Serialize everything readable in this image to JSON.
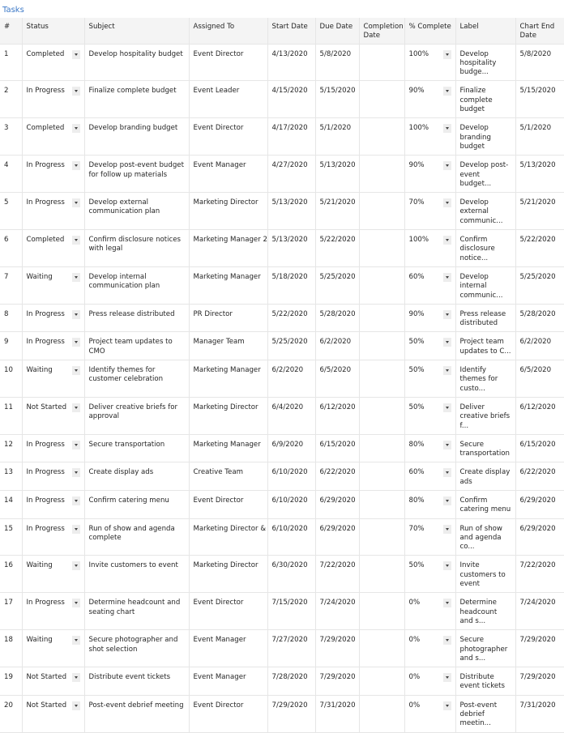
{
  "title": "Tasks",
  "columns": {
    "num": "#",
    "status": "Status",
    "subject": "Subject",
    "assigned": "Assigned To",
    "start": "Start Date",
    "due": "Due Date",
    "completion": "Completion Date",
    "pct": "% Complete",
    "label": "Label",
    "chart_end": "Chart End Date"
  },
  "rows": [
    {
      "num": "1",
      "status": "Completed",
      "subject": "Develop hospitality budget",
      "assigned": "Event Director",
      "start": "4/13/2020",
      "due": "5/8/2020",
      "completion": "",
      "pct": "100%",
      "label": "Develop hospitality budge...",
      "chart_end": "5/8/2020"
    },
    {
      "num": "2",
      "status": "In Progress",
      "subject": "Finalize complete budget",
      "assigned": "Event Leader",
      "start": "4/15/2020",
      "due": "5/15/2020",
      "completion": "",
      "pct": "90%",
      "label": "Finalize complete budget",
      "chart_end": "5/15/2020"
    },
    {
      "num": "3",
      "status": "Completed",
      "subject": "Develop branding budget",
      "assigned": "Event Director",
      "start": "4/17/2020",
      "due": "5/1/2020",
      "completion": "",
      "pct": "100%",
      "label": "Develop branding budget",
      "chart_end": "5/1/2020"
    },
    {
      "num": "4",
      "status": "In Progress",
      "subject": "Develop post-event budget for follow up materials",
      "assigned": "Event Manager",
      "start": "4/27/2020",
      "due": "5/13/2020",
      "completion": "",
      "pct": "90%",
      "label": "Develop post-event budget...",
      "chart_end": "5/13/2020"
    },
    {
      "num": "5",
      "status": "In Progress",
      "subject": "Develop external communication plan",
      "assigned": "Marketing Director",
      "start": "5/13/2020",
      "due": "5/21/2020",
      "completion": "",
      "pct": "70%",
      "label": "Develop external communic...",
      "chart_end": "5/21/2020"
    },
    {
      "num": "6",
      "status": "Completed",
      "subject": "Confirm disclosure notices with legal",
      "assigned": "Marketing Manager 2",
      "start": "5/13/2020",
      "due": "5/22/2020",
      "completion": "",
      "pct": "100%",
      "label": "Confirm disclosure notice...",
      "chart_end": "5/22/2020"
    },
    {
      "num": "7",
      "status": "Waiting",
      "subject": "Develop internal communication plan",
      "assigned": "Marketing Manager",
      "start": "5/18/2020",
      "due": "5/25/2020",
      "completion": "",
      "pct": "60%",
      "label": "Develop internal communic...",
      "chart_end": "5/25/2020"
    },
    {
      "num": "8",
      "status": "In Progress",
      "subject": "Press release distributed",
      "assigned": "PR Director",
      "start": "5/22/2020",
      "due": "5/28/2020",
      "completion": "",
      "pct": "90%",
      "label": "Press release distributed",
      "chart_end": "5/28/2020"
    },
    {
      "num": "9",
      "status": "In Progress",
      "subject": "Project team updates to CMO",
      "assigned": "Manager Team",
      "start": "5/25/2020",
      "due": "6/2/2020",
      "completion": "",
      "pct": "50%",
      "label": "Project team updates to C...",
      "chart_end": "6/2/2020"
    },
    {
      "num": "10",
      "status": "Waiting",
      "subject": "Identify themes for customer celebration",
      "assigned": "Marketing Manager",
      "start": "6/2/2020",
      "due": "6/5/2020",
      "completion": "",
      "pct": "50%",
      "label": "Identify themes for custo...",
      "chart_end": "6/5/2020"
    },
    {
      "num": "11",
      "status": "Not Started",
      "subject": "Deliver creative briefs for approval",
      "assigned": "Marketing Director",
      "start": "6/4/2020",
      "due": "6/12/2020",
      "completion": "",
      "pct": "50%",
      "label": "Deliver creative briefs f...",
      "chart_end": "6/12/2020"
    },
    {
      "num": "12",
      "status": "In Progress",
      "subject": "Secure transportation",
      "assigned": "Marketing Manager",
      "start": "6/9/2020",
      "due": "6/15/2020",
      "completion": "",
      "pct": "80%",
      "label": "Secure transportation",
      "chart_end": "6/15/2020"
    },
    {
      "num": "13",
      "status": "In Progress",
      "subject": "Create display ads",
      "assigned": "Creative Team",
      "start": "6/10/2020",
      "due": "6/22/2020",
      "completion": "",
      "pct": "60%",
      "label": "Create display ads",
      "chart_end": "6/22/2020"
    },
    {
      "num": "14",
      "status": "In Progress",
      "subject": "Confirm catering menu",
      "assigned": "Event Director",
      "start": "6/10/2020",
      "due": "6/29/2020",
      "completion": "",
      "pct": "80%",
      "label": "Confirm catering menu",
      "chart_end": "6/29/2020"
    },
    {
      "num": "15",
      "status": "In Progress",
      "subject": "Run of show and agenda complete",
      "assigned": "Marketing Director & E",
      "start": "6/10/2020",
      "due": "6/29/2020",
      "completion": "",
      "pct": "70%",
      "label": "Run of show and agenda co...",
      "chart_end": "6/29/2020"
    },
    {
      "num": "16",
      "status": "Waiting",
      "subject": "Invite customers to event",
      "assigned": "Marketing Director",
      "start": "6/30/2020",
      "due": "7/22/2020",
      "completion": "",
      "pct": "50%",
      "label": "Invite customers to event",
      "chart_end": "7/22/2020"
    },
    {
      "num": "17",
      "status": "In Progress",
      "subject": "Determine headcount and seating chart",
      "assigned": "Event Director",
      "start": "7/15/2020",
      "due": "7/24/2020",
      "completion": "",
      "pct": "0%",
      "label": "Determine headcount and s...",
      "chart_end": "7/24/2020"
    },
    {
      "num": "18",
      "status": "Waiting",
      "subject": "Secure photographer and shot selection",
      "assigned": "Event Manager",
      "start": "7/27/2020",
      "due": "7/29/2020",
      "completion": "",
      "pct": "0%",
      "label": "Secure photographer and s...",
      "chart_end": "7/29/2020"
    },
    {
      "num": "19",
      "status": "Not Started",
      "subject": "Distribute event tickets",
      "assigned": "Event Manager",
      "start": "7/28/2020",
      "due": "7/29/2020",
      "completion": "",
      "pct": "0%",
      "label": "Distribute event tickets",
      "chart_end": "7/29/2020"
    },
    {
      "num": "20",
      "status": "Not Started",
      "subject": "Post-event debrief meeting",
      "assigned": "Event Director",
      "start": "7/29/2020",
      "due": "7/31/2020",
      "completion": "",
      "pct": "0%",
      "label": "Post-event debrief meetin...",
      "chart_end": "7/31/2020"
    }
  ],
  "icons": {
    "dropdown": "chevron-down-icon"
  }
}
